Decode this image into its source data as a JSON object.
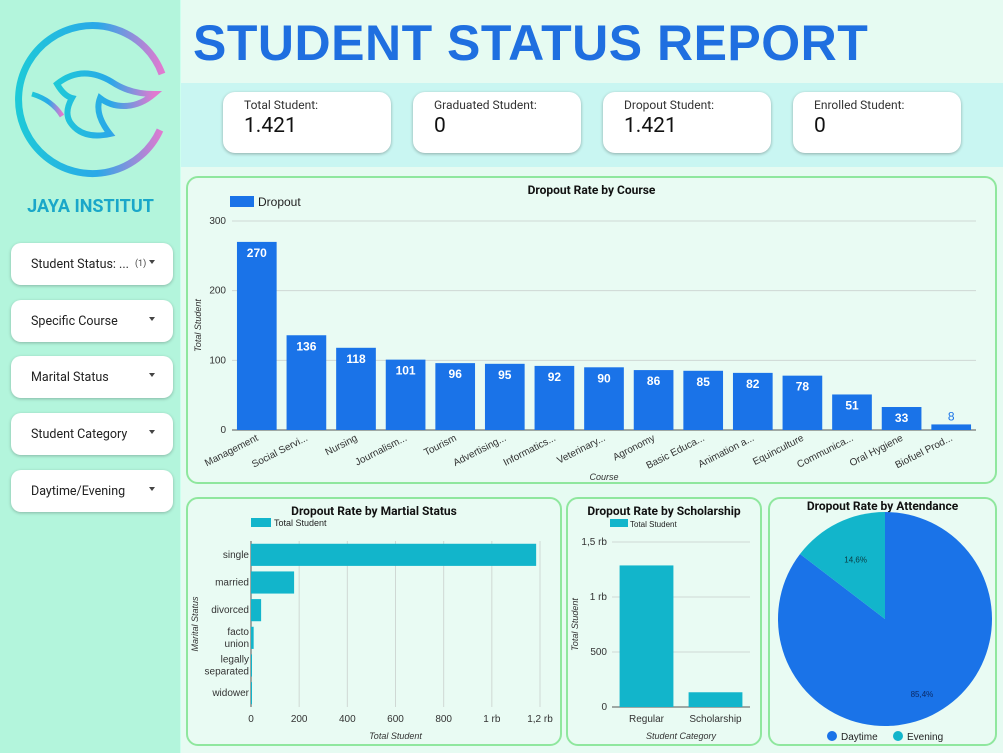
{
  "sidebar": {
    "brand": "JAYA INSTITUT",
    "filters": [
      {
        "label": "Student Status: ...",
        "count": "(1)"
      },
      {
        "label": "Specific Course",
        "count": ""
      },
      {
        "label": "Marital Status",
        "count": ""
      },
      {
        "label": "Student Category",
        "count": ""
      },
      {
        "label": "Daytime/Evening",
        "count": ""
      }
    ]
  },
  "header": {
    "title": "STUDENT STATUS REPORT"
  },
  "kpis": [
    {
      "label": "Total Student:",
      "value": "1.421"
    },
    {
      "label": "Graduated Student:",
      "value": "0"
    },
    {
      "label": "Dropout Student:",
      "value": "1.421"
    },
    {
      "label": "Enrolled Student:",
      "value": "0"
    }
  ],
  "colors": {
    "primary": "#1f6fe0",
    "bar": "#1a73e8",
    "teal": "#12b5cb",
    "panel_border": "#8fe79e"
  },
  "chart_data": [
    {
      "type": "bar",
      "title": "Dropout Rate by Course",
      "legend": [
        "Dropout"
      ],
      "xlabel": "Course",
      "ylabel": "Total Student",
      "ylim": [
        0,
        300
      ],
      "yticks": [
        "0",
        "100",
        "200",
        "300"
      ],
      "categories": [
        "Management",
        "Social Servi...",
        "Nursing",
        "Journalism...",
        "Tourism",
        "Advertising...",
        "Informatics...",
        "Veterinary...",
        "Agronomy",
        "Basic Educa...",
        "Animation a...",
        "Equinculture",
        "Communica...",
        "Oral Hygiene",
        "Biofuel Prod..."
      ],
      "values": [
        270,
        136,
        118,
        101,
        96,
        95,
        92,
        90,
        86,
        85,
        82,
        78,
        51,
        33,
        8
      ]
    },
    {
      "type": "bar",
      "orientation": "horizontal",
      "title": "Dropout Rate by Martial Status",
      "legend": [
        "Total Student"
      ],
      "xlabel": "Total Student",
      "ylabel": "Marital Status",
      "xlim": [
        0,
        1200
      ],
      "xticks": [
        "0",
        "200",
        "400",
        "600",
        "800",
        "1 rb",
        "1,2 rb"
      ],
      "categories": [
        [
          "single"
        ],
        [
          "married"
        ],
        [
          "divorced"
        ],
        [
          "facto",
          "union"
        ],
        [
          "legally",
          "separated"
        ],
        [
          "widower"
        ]
      ],
      "values": [
        1184,
        179,
        42,
        11,
        4,
        1
      ]
    },
    {
      "type": "bar",
      "title": "Dropout Rate by Scholarship",
      "legend": [
        "Total Student"
      ],
      "xlabel": "Student Category",
      "ylabel": "Total Student",
      "ylim": [
        0,
        1500
      ],
      "yticks": [
        "0",
        "500",
        "1 rb",
        "1,5 rb"
      ],
      "categories": [
        "Regular",
        "Scholarship"
      ],
      "values": [
        1287,
        134
      ]
    },
    {
      "type": "pie",
      "title": "Dropout Rate by Attendance",
      "legend": [
        "Daytime",
        "Evening"
      ],
      "values": [
        85.4,
        14.6
      ],
      "labels": [
        "85,4%",
        "14,6%"
      ]
    }
  ]
}
